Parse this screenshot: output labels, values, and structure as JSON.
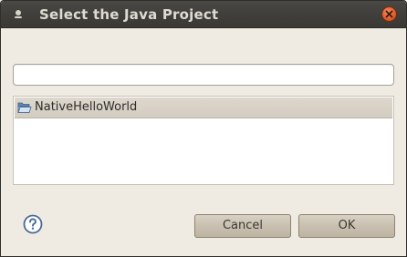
{
  "window": {
    "title": "Select the Java Project"
  },
  "filter": {
    "value": "",
    "placeholder": ""
  },
  "projects": [
    {
      "label": "NativeHelloWorld",
      "icon": "open-folder-icon",
      "selected": true
    }
  ],
  "buttons": {
    "cancel_label": "Cancel",
    "ok_label": "OK"
  },
  "colors": {
    "titlebar": "#3f3e3a",
    "title_text": "#dfdbd2",
    "close_button": "#e0602f",
    "dialog_background": "#f0ebe2",
    "selection": "#d6d0c4",
    "help_icon": "#4a6a9a"
  },
  "icons": {
    "window_menu": "window-menu-icon",
    "close": "close-icon",
    "help": "help-icon"
  }
}
